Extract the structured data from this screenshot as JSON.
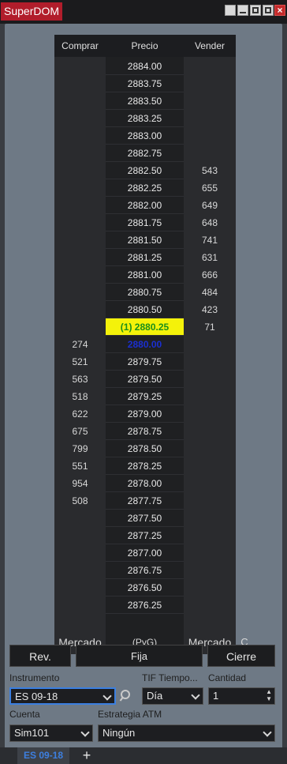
{
  "window": {
    "title": "SuperDOM"
  },
  "dom": {
    "headers": {
      "bid": "Comprar",
      "price": "Precio",
      "ask": "Vender"
    },
    "rows": [
      {
        "price": "2884.00",
        "bid": "",
        "ask": ""
      },
      {
        "price": "2883.75",
        "bid": "",
        "ask": ""
      },
      {
        "price": "2883.50",
        "bid": "",
        "ask": ""
      },
      {
        "price": "2883.25",
        "bid": "",
        "ask": ""
      },
      {
        "price": "2883.00",
        "bid": "",
        "ask": ""
      },
      {
        "price": "2882.75",
        "bid": "",
        "ask": ""
      },
      {
        "price": "2882.50",
        "bid": "",
        "ask": "543"
      },
      {
        "price": "2882.25",
        "bid": "",
        "ask": "655"
      },
      {
        "price": "2882.00",
        "bid": "",
        "ask": "649"
      },
      {
        "price": "2881.75",
        "bid": "",
        "ask": "648"
      },
      {
        "price": "2881.50",
        "bid": "",
        "ask": "741"
      },
      {
        "price": "2881.25",
        "bid": "",
        "ask": "631"
      },
      {
        "price": "2881.00",
        "bid": "",
        "ask": "666"
      },
      {
        "price": "2880.75",
        "bid": "",
        "ask": "484"
      },
      {
        "price": "2880.50",
        "bid": "",
        "ask": "423"
      },
      {
        "price": "(1) 2880.25",
        "bid": "",
        "ask": "71",
        "state": "position"
      },
      {
        "price": "2880.00",
        "bid": "274",
        "ask": "",
        "state": "last"
      },
      {
        "price": "2879.75",
        "bid": "521",
        "ask": ""
      },
      {
        "price": "2879.50",
        "bid": "563",
        "ask": ""
      },
      {
        "price": "2879.25",
        "bid": "518",
        "ask": ""
      },
      {
        "price": "2879.00",
        "bid": "622",
        "ask": ""
      },
      {
        "price": "2878.75",
        "bid": "675",
        "ask": ""
      },
      {
        "price": "2878.50",
        "bid": "799",
        "ask": ""
      },
      {
        "price": "2878.25",
        "bid": "551",
        "ask": ""
      },
      {
        "price": "2878.00",
        "bid": "954",
        "ask": ""
      },
      {
        "price": "2877.75",
        "bid": "508",
        "ask": ""
      },
      {
        "price": "2877.50",
        "bid": "",
        "ask": ""
      },
      {
        "price": "2877.25",
        "bid": "",
        "ask": ""
      },
      {
        "price": "2877.00",
        "bid": "",
        "ask": ""
      },
      {
        "price": "2876.75",
        "bid": "",
        "ask": ""
      },
      {
        "price": "2876.50",
        "bid": "",
        "ask": ""
      },
      {
        "price": "2876.25",
        "bid": "",
        "ask": ""
      }
    ],
    "footer": {
      "bid_market": "Mercado",
      "pnl": "(PyG)",
      "ask_market": "Mercado",
      "c": "C"
    }
  },
  "controls": {
    "rev": "Rev.",
    "fija": "Fija",
    "cierre": "Cierre",
    "instrument_label": "Instrumento",
    "instrument_value": "ES 09-18",
    "tif_label": "TIF Tiempo...",
    "tif_value": "Día",
    "qty_label": "Cantidad",
    "qty_value": "1",
    "account_label": "Cuenta",
    "account_value": "Sim101",
    "atm_label": "Estrategia ATM",
    "atm_value": "Ningún"
  },
  "tabs": [
    {
      "label": "ES 09-18"
    }
  ],
  "icons": {
    "search": "search-icon",
    "add": "plus-icon",
    "minimize": "minimize-icon",
    "maximize": "maximize-icon",
    "close": "close-icon"
  }
}
